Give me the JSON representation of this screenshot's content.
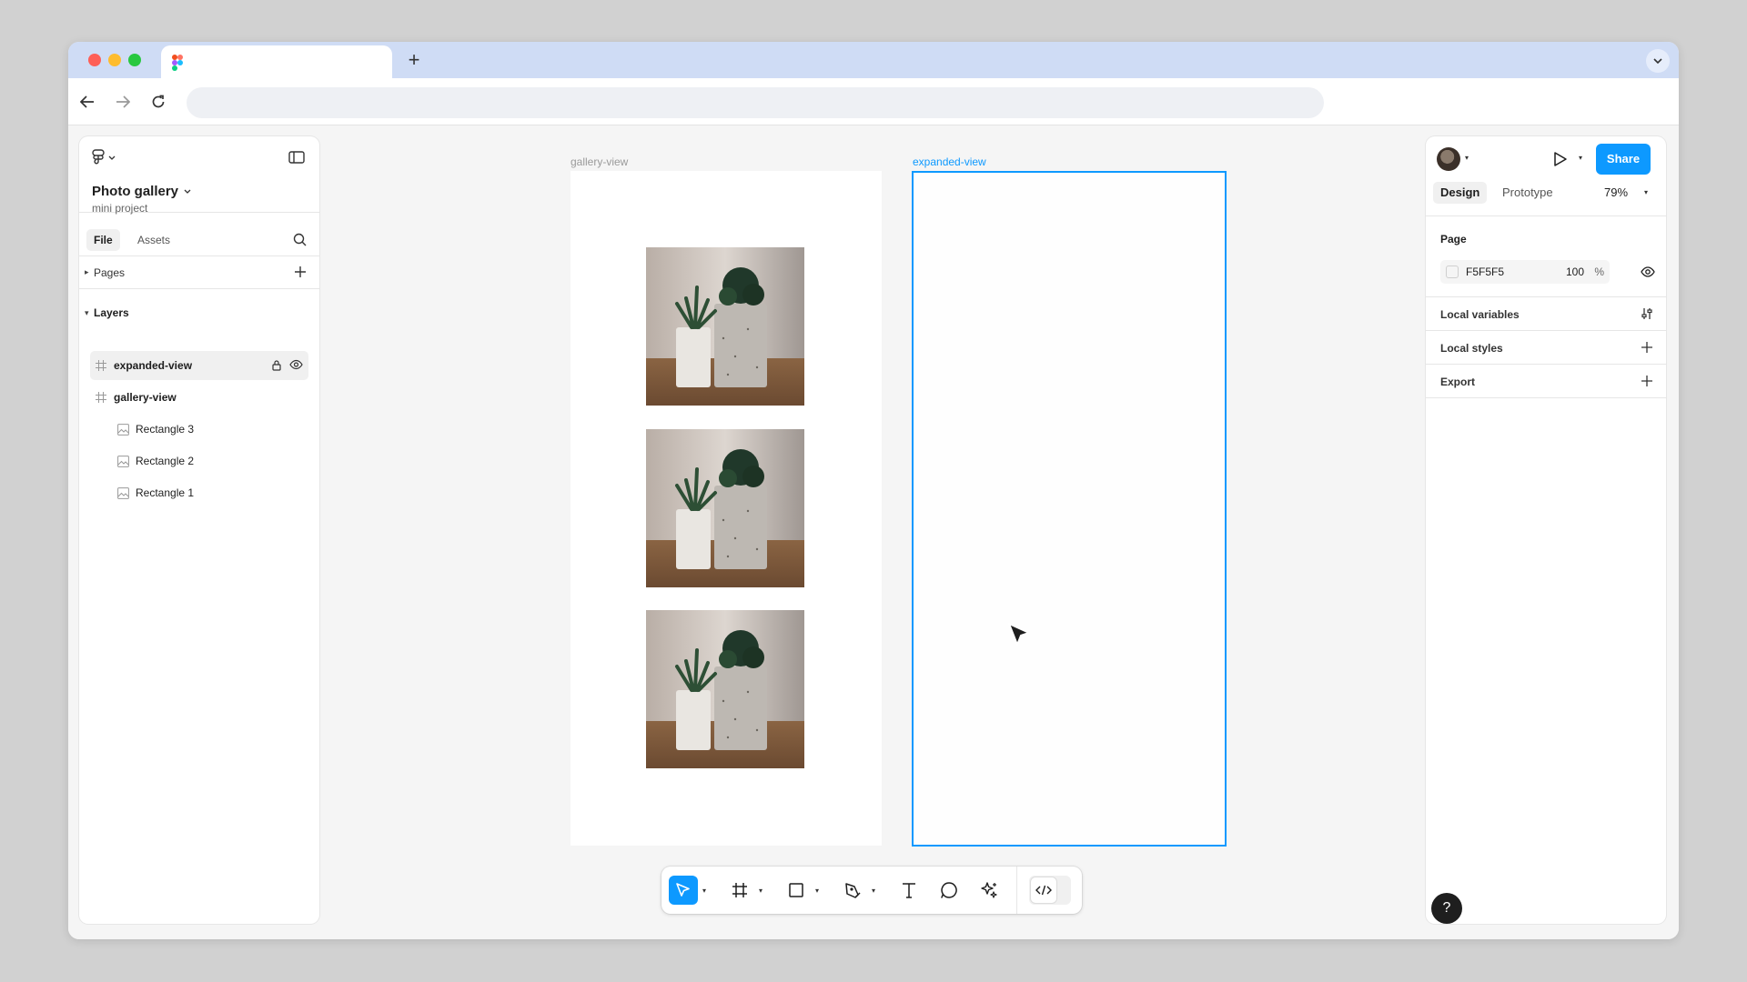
{
  "browser": {
    "new_tab_symbol": "+",
    "url": ""
  },
  "left_panel": {
    "project_title": "Photo gallery",
    "project_subtitle": "mini project",
    "tabs": {
      "file": "File",
      "assets": "Assets"
    },
    "pages_label": "Pages",
    "layers_label": "Layers",
    "layers": [
      {
        "name": "expanded-view",
        "type": "frame"
      },
      {
        "name": "gallery-view",
        "type": "frame"
      },
      {
        "name": "Rectangle 3",
        "type": "image"
      },
      {
        "name": "Rectangle 2",
        "type": "image"
      },
      {
        "name": "Rectangle 1",
        "type": "image"
      }
    ]
  },
  "canvas": {
    "frames": [
      {
        "label": "gallery-view"
      },
      {
        "label": "expanded-view"
      }
    ]
  },
  "right_panel": {
    "share_label": "Share",
    "tabs": {
      "design": "Design",
      "prototype": "Prototype"
    },
    "zoom": "79%",
    "page_section_title": "Page",
    "page_color_hex": "F5F5F5",
    "page_opacity": "100",
    "page_opacity_unit": "%",
    "sections": {
      "local_variables": "Local variables",
      "local_styles": "Local styles",
      "export": "Export"
    }
  },
  "help_label": "?",
  "colors": {
    "accent": "#0d99ff",
    "canvas_bg": "#f5f5f5",
    "tabbar_bg": "#cfdcf5"
  }
}
